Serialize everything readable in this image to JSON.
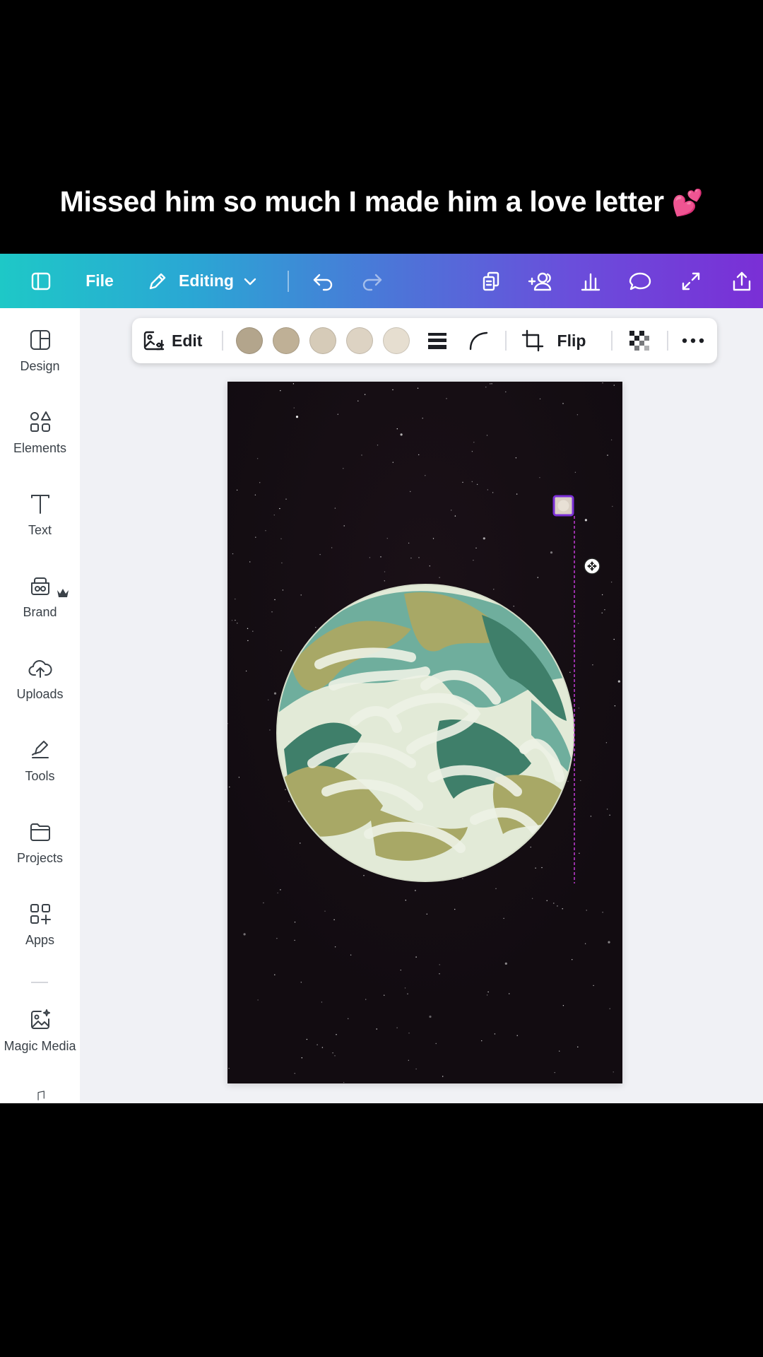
{
  "caption": {
    "text": "Missed him so much I made him a love letter",
    "emoji": "💕"
  },
  "topbar": {
    "file_label": "File",
    "mode_label": "Editing",
    "icons": [
      "panel-toggle-icon",
      "pencil-icon",
      "chevron-down-icon",
      "undo-icon",
      "redo-icon",
      "copy-pages-icon",
      "share-people-icon",
      "analytics-icon",
      "comment-icon",
      "fullscreen-icon",
      "upload-share-icon"
    ]
  },
  "toolbar": {
    "edit_label": "Edit",
    "flip_label": "Flip",
    "swatches": [
      "#b3a58c",
      "#bfb096",
      "#d6cbb8",
      "#ddd3c3",
      "#e6ded0"
    ]
  },
  "sidebar": {
    "items": [
      {
        "label": "Design",
        "icon": "design-icon"
      },
      {
        "label": "Elements",
        "icon": "elements-icon"
      },
      {
        "label": "Text",
        "icon": "text-icon"
      },
      {
        "label": "Brand",
        "icon": "brand-icon"
      },
      {
        "label": "Uploads",
        "icon": "uploads-icon"
      },
      {
        "label": "Tools",
        "icon": "tools-icon"
      },
      {
        "label": "Projects",
        "icon": "projects-icon"
      },
      {
        "label": "Apps",
        "icon": "apps-icon"
      },
      {
        "label": "Magic Media",
        "icon": "magic-media-icon"
      }
    ]
  },
  "colors": {
    "gradient_start": "#1ec8c7",
    "gradient_end": "#7a2fd6",
    "canvas_bg": "#130d12",
    "selection": "#7a2fd6"
  }
}
